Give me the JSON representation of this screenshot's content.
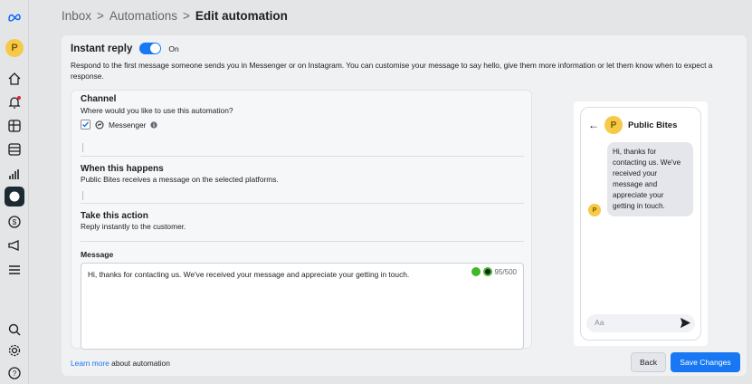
{
  "breadcrumb": {
    "inbox": "Inbox",
    "automations": "Automations",
    "current": "Edit automation",
    "sep": ">"
  },
  "sidebar": {
    "avatar_initial": "P"
  },
  "instant_reply": {
    "title": "Instant reply",
    "toggle_state": "On",
    "description": "Respond to the first message someone sends you in Messenger or on Instagram. You can customise your message to say hello, give them more information or let them know when to expect a response."
  },
  "channel": {
    "title": "Channel",
    "subtitle": "Where would you like to use this automation?",
    "option": "Messenger"
  },
  "trigger": {
    "title": "When this happens",
    "subtitle": "Public Bites receives a message on the selected platforms."
  },
  "action": {
    "title": "Take this action",
    "subtitle": "Reply instantly to the customer."
  },
  "message": {
    "label": "Message",
    "text": "Hi, thanks for contacting us. We've received your message and appreciate your getting in touch.",
    "counter": "95/500"
  },
  "footer": {
    "learn_link": "Learn more",
    "learn_rest": " about automation",
    "back": "Back",
    "save": "Save Changes"
  },
  "preview": {
    "page_name": "Public Bites",
    "initial": "P",
    "bubble": "Hi, thanks for contacting us. We've received your message and appreciate your getting in touch.",
    "input_placeholder": "Aa"
  },
  "colors": {
    "accent": "#1877f2",
    "avatar": "#f7c948"
  }
}
